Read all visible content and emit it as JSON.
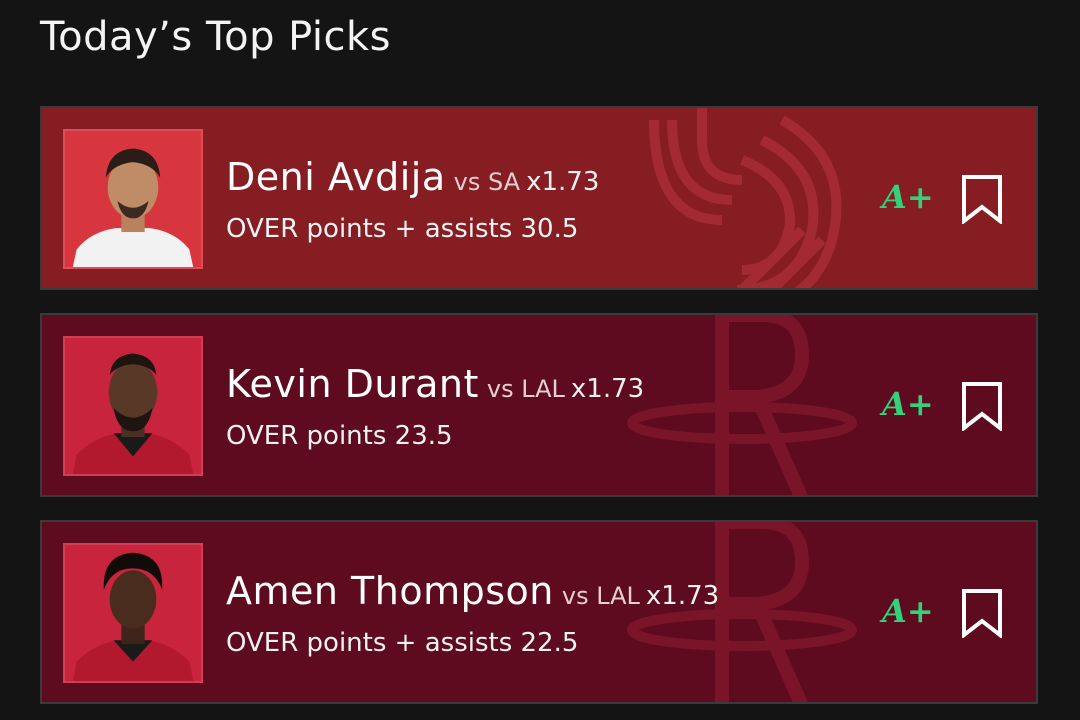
{
  "header": {
    "title": "Today’s Top Picks"
  },
  "picks": [
    {
      "player": "Deni Avdija",
      "opponent": "vs SA",
      "multiplier": "x1.73",
      "line": "OVER points + assists 30.5",
      "grade": "A+",
      "team_logo_icon": "portland-trail-blazers-pinwheel-icon",
      "card_color": "#861d22",
      "photo_bg": "#d8363f"
    },
    {
      "player": "Kevin Durant",
      "opponent": "vs LAL",
      "multiplier": "x1.73",
      "line": "OVER points 23.5",
      "grade": "A+",
      "team_logo_icon": "houston-rockets-r-icon",
      "card_color": "#5e0a1f",
      "photo_bg": "#c8243d"
    },
    {
      "player": "Amen Thompson",
      "opponent": "vs LAL",
      "multiplier": "x1.73",
      "line": "OVER points + assists 22.5",
      "grade": "A+",
      "team_logo_icon": "houston-rockets-r-icon",
      "card_color": "#5e0a1f",
      "photo_bg": "#c8243d"
    }
  ],
  "colors": {
    "grade": "#35d07a",
    "background": "#141414"
  }
}
